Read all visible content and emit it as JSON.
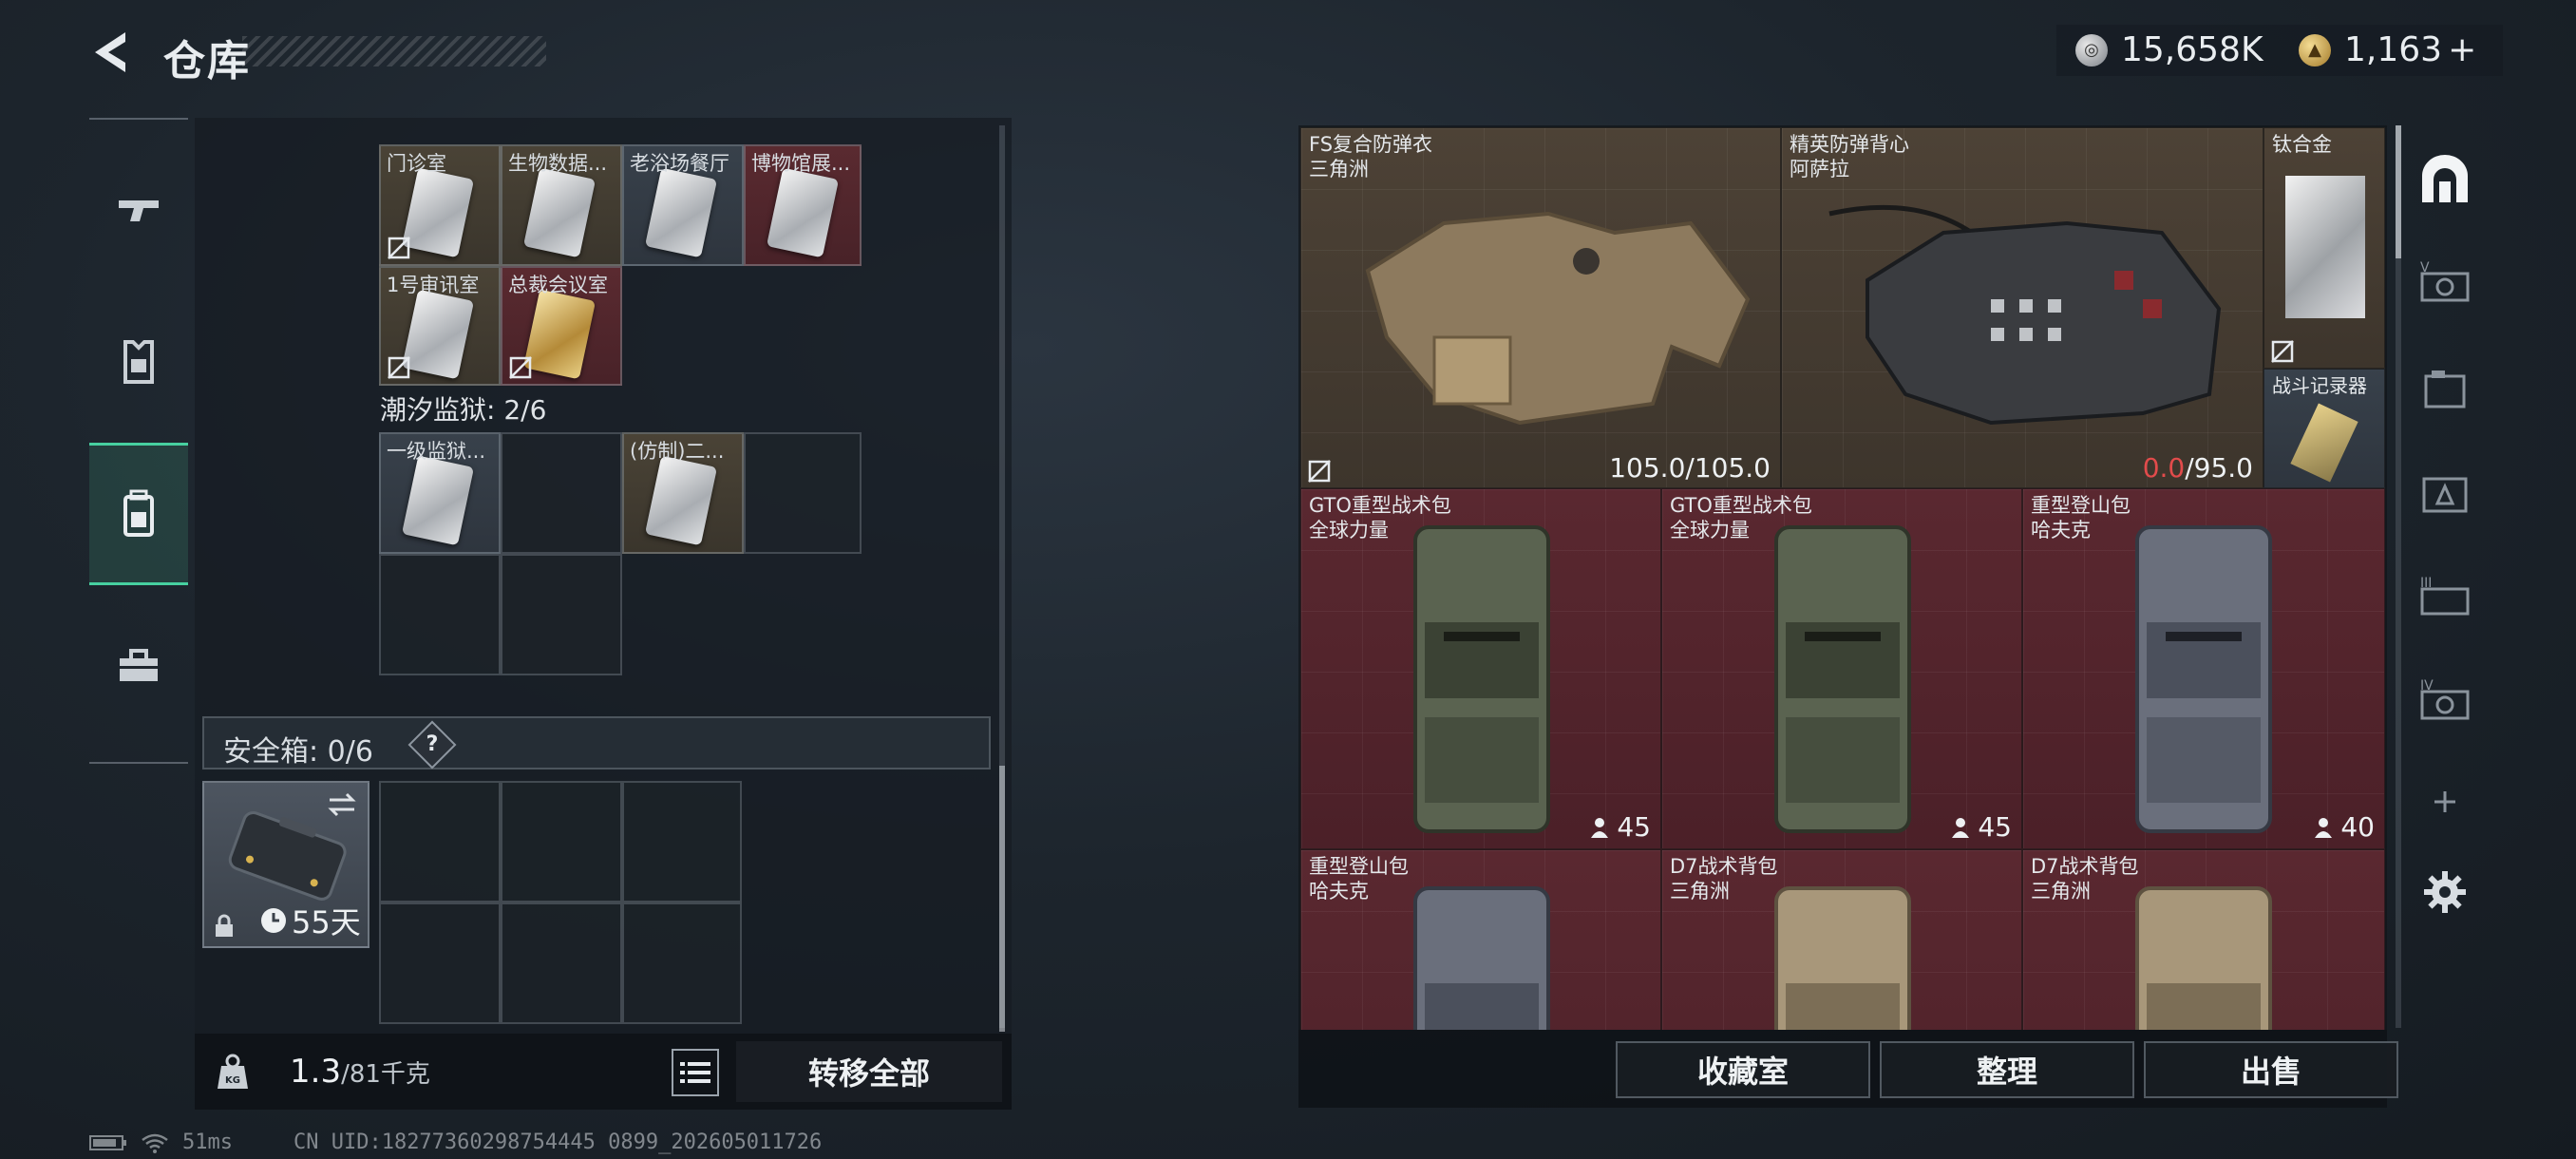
{
  "header": {
    "title": "仓库",
    "currency_silver": "15,658K",
    "currency_gold": "1,163",
    "plus": "+"
  },
  "left_nav": [
    "weapons-icon",
    "armor-icon",
    "backpack-icon",
    "toolbox-icon"
  ],
  "storage": {
    "access_cards": [
      {
        "label": "门诊室",
        "color": "silver",
        "bg": "brown"
      },
      {
        "label": "生物数据...",
        "color": "silver",
        "bg": "brown"
      },
      {
        "label": "老浴场餐厅",
        "color": "silver",
        "bg": "slate"
      },
      {
        "label": "博物馆展...",
        "color": "silver",
        "bg": "red"
      },
      {
        "label": "1号审讯室",
        "color": "silver",
        "bg": "brown"
      },
      {
        "label": "总裁会议室",
        "color": "gold",
        "bg": "red"
      }
    ],
    "prison_section": "潮汐监狱: 2/6",
    "prison_cards": [
      {
        "label": "一级监狱...",
        "bg": "slate"
      },
      {
        "label": "(仿制)二...",
        "bg": "brown"
      }
    ],
    "safe_box_label": "安全箱: 0/6",
    "help": "?",
    "safe_case_days": "55天",
    "weight_current": "1.3",
    "weight_max": "/81千克",
    "transfer_all": "转移全部",
    "weight_icon_text": "KG"
  },
  "inventory": {
    "armors": [
      {
        "name": "FS复合防弹衣",
        "faction": "三角洲",
        "durability_current": "105.0",
        "durability_max": "/105.0"
      },
      {
        "name": "精英防弹背心",
        "faction": "阿萨拉",
        "durability_current": "0.0",
        "durability_max": "/95.0"
      }
    ],
    "small_items": [
      {
        "name": "钛合金"
      },
      {
        "name": "战斗记录器"
      }
    ],
    "backpacks": [
      {
        "name": "GTO重型战术包",
        "faction": "全球力量",
        "capacity": "45",
        "color": "olive"
      },
      {
        "name": "GTO重型战术包",
        "faction": "全球力量",
        "capacity": "45",
        "color": "olive"
      },
      {
        "name": "重型登山包",
        "faction": "哈夫克",
        "capacity": "40",
        "color": "gray"
      },
      {
        "name": "重型登山包",
        "faction": "哈夫克",
        "capacity": "",
        "color": "gray"
      },
      {
        "name": "D7战术背包",
        "faction": "三角洲",
        "capacity": "",
        "color": "tan"
      },
      {
        "name": "D7战术背包",
        "faction": "三角洲",
        "capacity": "",
        "color": "tan"
      }
    ],
    "buttons": {
      "collection": "收藏室",
      "organize": "整理",
      "sell": "出售"
    }
  },
  "right_nav": [
    "home-base-icon",
    "tier-v-icon",
    "tier-1-icon",
    "tier-2-icon",
    "tier-3-icon",
    "tier-4-icon",
    "add-icon",
    "settings-icon"
  ],
  "right_nav_labels": {
    "v": "V",
    "iii": "III",
    "iv": "IV"
  },
  "status": {
    "ping": "51ms",
    "uid": "CN UID:18277360298754445 0899_202605011726"
  },
  "colors": {
    "accent_green": "#47d0a0",
    "durability_red": "#e24b4b",
    "bag_red": "#5a2830",
    "armor_brown": "#4d4236"
  }
}
